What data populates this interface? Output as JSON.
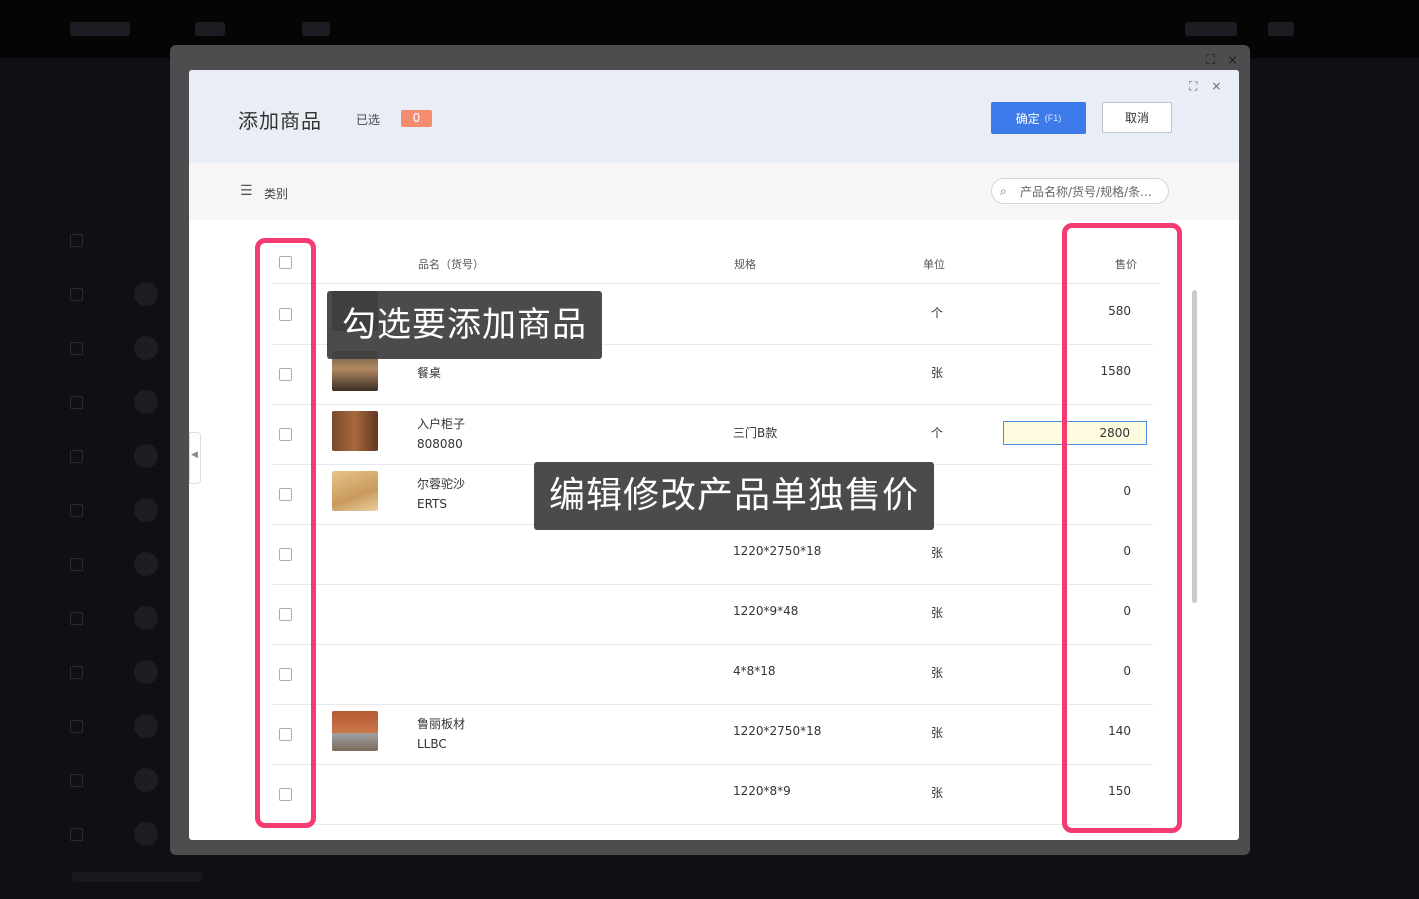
{
  "dialog": {
    "title": "添加商品",
    "selected_label": "已选",
    "selected_count": "0",
    "confirm_label": "确定",
    "confirm_hint": "(F1)",
    "cancel_label": "取消",
    "maximize_icon": "⛶",
    "close_icon": "×"
  },
  "toolbar": {
    "category_icon": "☰",
    "category_label": "类别",
    "search_icon": "⌕",
    "search_placeholder": "产品名称/货号/规格/条..."
  },
  "table": {
    "headers": {
      "name": "品名（货号）",
      "spec": "规格",
      "unit": "单位",
      "price": "售价"
    },
    "rows": [
      {
        "name": "",
        "code": "",
        "spec": "",
        "unit": "个",
        "price": "580",
        "thumb": "dark-furniture"
      },
      {
        "name": "餐桌",
        "code": "",
        "spec": "",
        "unit": "张",
        "price": "1580",
        "thumb": "dining-table"
      },
      {
        "name": "入户柜子",
        "code": "808080",
        "spec": "三门B款",
        "unit": "个",
        "price": "2800",
        "thumb": "wood-cabinet",
        "editing": true
      },
      {
        "name": "尔蓉驼沙",
        "code": "ERTS",
        "spec": "",
        "unit": "",
        "price": "0",
        "thumb": "wood-board"
      },
      {
        "name": "",
        "code": "",
        "spec": "1220*2750*18",
        "unit": "张",
        "price": "0"
      },
      {
        "name": "",
        "code": "",
        "spec": "1220*9*48",
        "unit": "张",
        "price": "0"
      },
      {
        "name": "",
        "code": "",
        "spec": "4*8*18",
        "unit": "张",
        "price": "0"
      },
      {
        "name": "鲁丽板材",
        "code": "LLBC",
        "spec": "1220*2750*18",
        "unit": "张",
        "price": "140",
        "thumb": "wood-samples"
      },
      {
        "name": "",
        "code": "",
        "spec": "1220*8*9",
        "unit": "张",
        "price": "150"
      }
    ]
  },
  "annotations": {
    "select_callout": "勾选要添加商品",
    "price_callout": "编辑修改产品单独售价",
    "highlight_color": "#f43b72"
  }
}
